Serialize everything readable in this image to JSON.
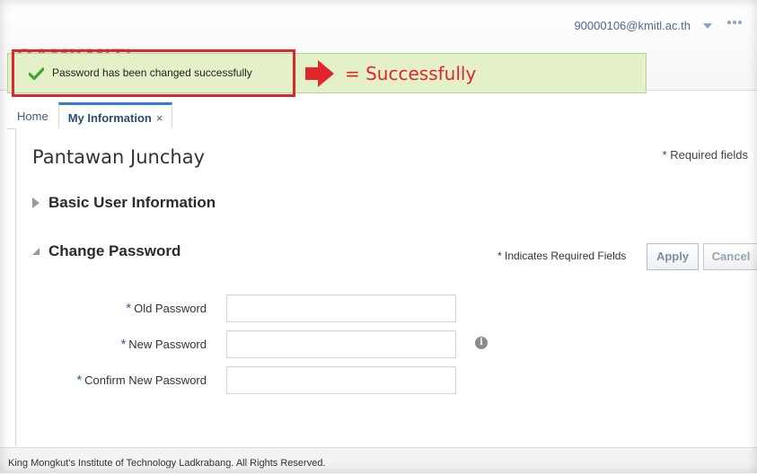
{
  "header": {
    "user_email": "90000106@kmitl.ac.th",
    "logo_text": "OAMKMITL"
  },
  "banner": {
    "message": "Password has been changed successfully",
    "result_label": "= Successfully",
    "success_color": "#3aa62b",
    "highlight_color": "#e0262b"
  },
  "tabs": [
    {
      "label": "Home"
    },
    {
      "label": "My Information",
      "close": "×"
    }
  ],
  "profile": {
    "name": "Pantawan Junchay",
    "required_note": "* Required fields"
  },
  "sections": {
    "basic": "Basic User Information",
    "change_password": "Change Password"
  },
  "actions": {
    "indicator": "* Indicates Required Fields",
    "apply": "Apply",
    "cancel": "Cancel"
  },
  "form": {
    "required_mark": "*",
    "old_password_label": "Old Password",
    "new_password_label": "New Password",
    "confirm_password_label": "Confirm New Password",
    "old_password_value": "",
    "new_password_value": "",
    "confirm_password_value": "",
    "info_glyph": "i"
  },
  "footer": {
    "text": "King Mongkut's Institute of Technology Ladkrabang. All Rights Reserved."
  }
}
